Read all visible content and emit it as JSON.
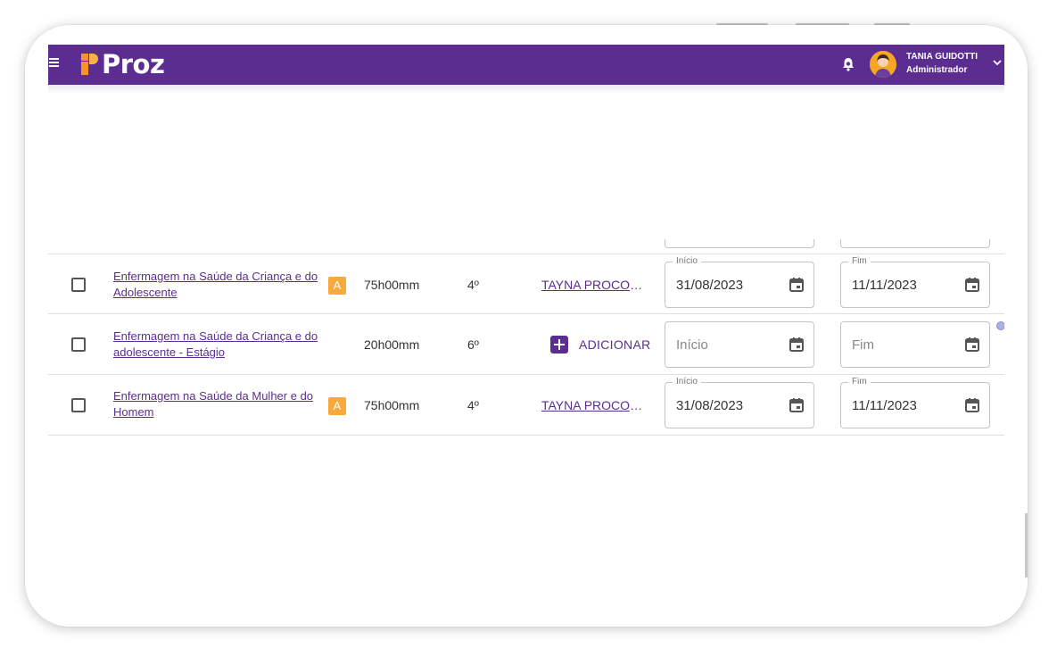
{
  "header": {
    "brand": "Proz",
    "user_name": "TANIA GUIDOTTI",
    "user_role": "Administrador",
    "colors": {
      "bar": "#5c2d91",
      "logo_accent": "#f7931e"
    }
  },
  "rows": [
    {
      "course": "Enfermagem na Saúde da Criança e do Adolescente",
      "badge": "A",
      "hours": "75h00mm",
      "semester": "4º",
      "teacher": "TAYNA PROCOPIO",
      "start_label": "Início",
      "start_value": "31/08/2023",
      "end_label": "Fim",
      "end_value": "11/11/2023"
    },
    {
      "course": "Enfermagem na Saúde da Criança e do adolescente - Estágio",
      "hours": "20h00mm",
      "semester": "6º",
      "add_label": "ADICIONAR",
      "start_placeholder": "Início",
      "end_placeholder": "Fim"
    },
    {
      "course": "Enfermagem na Saúde da Mulher e do Homem",
      "badge": "A",
      "hours": "75h00mm",
      "semester": "4º",
      "teacher": "TAYNA PROCOPIO",
      "start_label": "Início",
      "start_value": "31/08/2023",
      "end_label": "Fim",
      "end_value": "11/11/2023"
    }
  ],
  "icons": [
    "menu-icon",
    "bell-icon",
    "avatar",
    "chevron-down-icon",
    "calendar-icon",
    "plus-icon"
  ]
}
